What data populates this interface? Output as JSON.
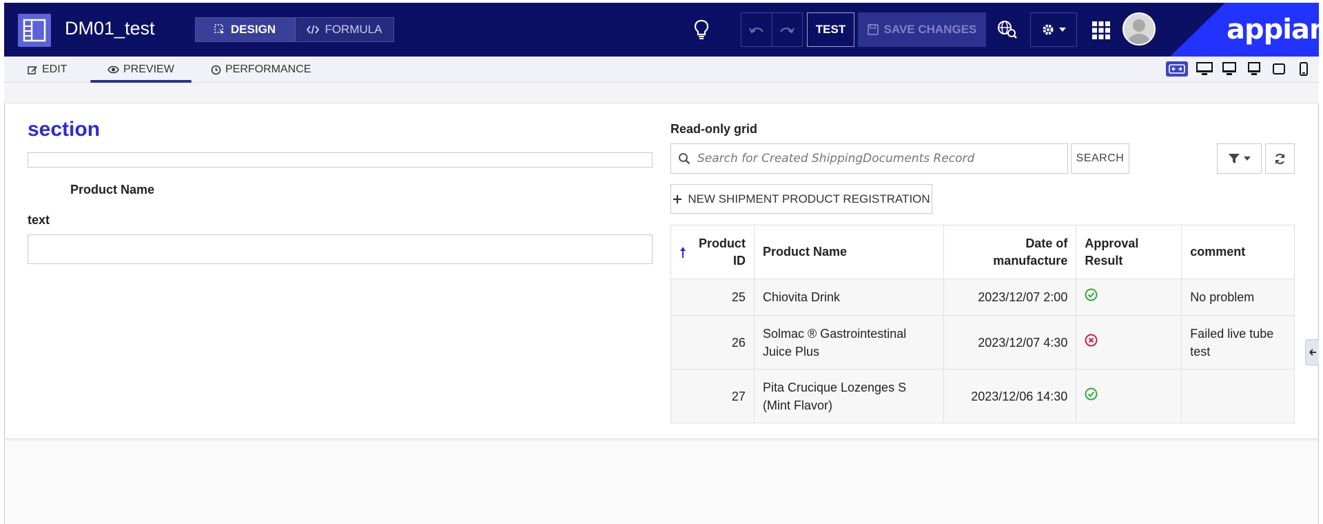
{
  "header": {
    "app_title": "DM01_test",
    "design_label": "DESIGN",
    "formula_label": "FORMULA",
    "test_label": "TEST",
    "save_label": "SAVE CHANGES",
    "brand": "appian",
    "colors": {
      "topbar": "#0b1064",
      "brand": "#2233ff",
      "accent": "#3a47b8"
    }
  },
  "subbar": {
    "tabs": [
      {
        "label": "EDIT",
        "icon": "edit-icon"
      },
      {
        "label": "PREVIEW",
        "icon": "eye-icon",
        "active": true
      },
      {
        "label": "PERFORMANCE",
        "icon": "clock-icon"
      }
    ],
    "devices": [
      "fit-width-icon",
      "desktop-icon",
      "laptop-icon",
      "tablet-landscape-icon",
      "tablet-portrait-icon",
      "phone-icon"
    ]
  },
  "form": {
    "section_title": "section",
    "product_name_label": "Product Name",
    "text_label": "text",
    "text_value": ""
  },
  "grid": {
    "label": "Read-only grid",
    "search_placeholder": "Search for Created ShippingDocuments Record",
    "search_button": "SEARCH",
    "new_button": "NEW SHIPMENT PRODUCT REGISTRATION",
    "columns": {
      "product_id": "Product ID",
      "product_name": "Product Name",
      "date": "Date of manufacture",
      "approval": "Approval Result",
      "comment": "comment"
    },
    "rows": [
      {
        "id": "25",
        "name": "Chiovita Drink",
        "date": "2023/12/07 2:00",
        "approval": "approved",
        "comment": "No problem"
      },
      {
        "id": "26",
        "name": "Solmac ® Gastrointestinal Juice Plus",
        "date": "2023/12/07 4:30",
        "approval": "rejected",
        "comment": "Failed live tube test"
      },
      {
        "id": "27",
        "name": "Pita Crucique Lozenges S (Mint Flavor)",
        "date": "2023/12/06 14:30",
        "approval": "approved",
        "comment": ""
      }
    ]
  }
}
